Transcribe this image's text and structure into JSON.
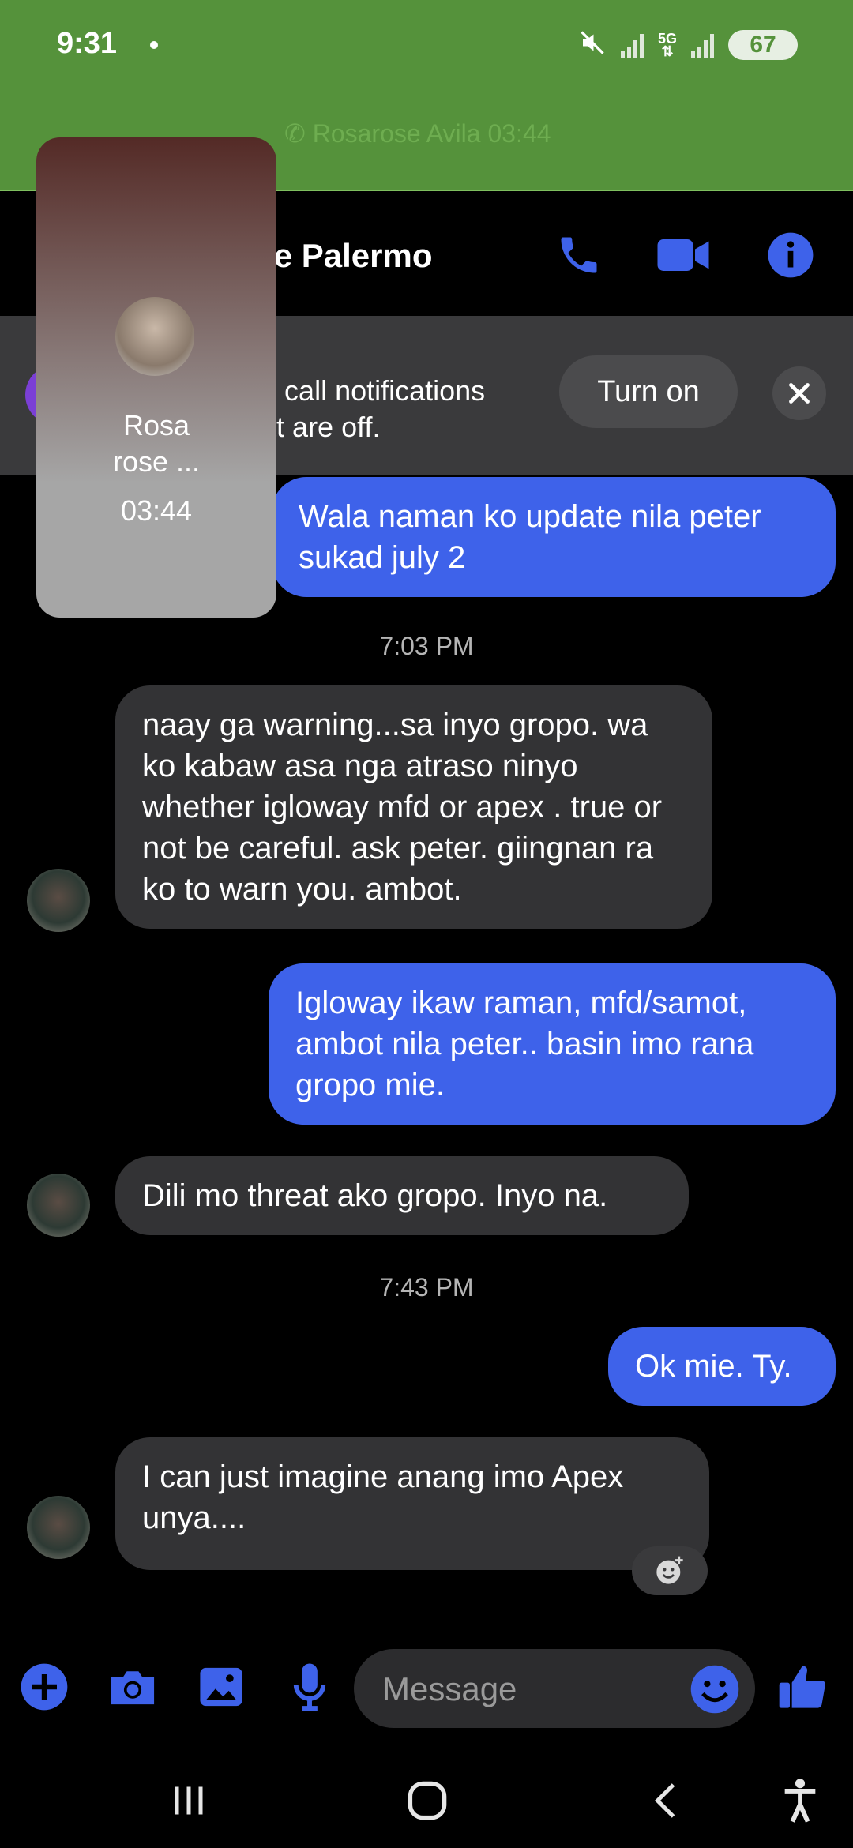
{
  "status_bar": {
    "time": "9:31",
    "network": "5G",
    "battery": "67"
  },
  "ongoing_call": {
    "label": "Rosarose Avila 03:44"
  },
  "header": {
    "title": "yce Palermo"
  },
  "notification_banner": {
    "line1": "nd call notifications",
    "line2": "hat are off.",
    "turn_on_label": "Turn on"
  },
  "call_pip": {
    "name_line1": "Rosa",
    "name_line2": "rose ...",
    "duration": "03:44"
  },
  "messages": [
    {
      "direction": "outgoing",
      "text": "Wala naman ko update nila peter sukad july 2"
    },
    {
      "type": "timestamp",
      "text": "7:03 PM"
    },
    {
      "direction": "incoming",
      "text": "naay ga warning...sa inyo gropo. wa ko kabaw asa nga atraso ninyo whether igloway mfd or apex . true or not be careful. ask peter. giingnan ra ko to warn you. ambot."
    },
    {
      "direction": "outgoing",
      "text": "Igloway ikaw raman, mfd/samot, ambot nila peter.. basin imo rana gropo mie."
    },
    {
      "direction": "incoming",
      "text": "Dili mo threat ako gropo. Inyo na."
    },
    {
      "type": "timestamp",
      "text": "7:43 PM"
    },
    {
      "direction": "outgoing",
      "text": "Ok mie. Ty."
    },
    {
      "direction": "incoming",
      "text": "I can just imagine anang imo Apex unya...."
    }
  ],
  "composer": {
    "placeholder": "Message"
  },
  "colors": {
    "accent": "#3e62ea",
    "status_bar": "#55923b",
    "incoming_bubble": "#333335"
  }
}
